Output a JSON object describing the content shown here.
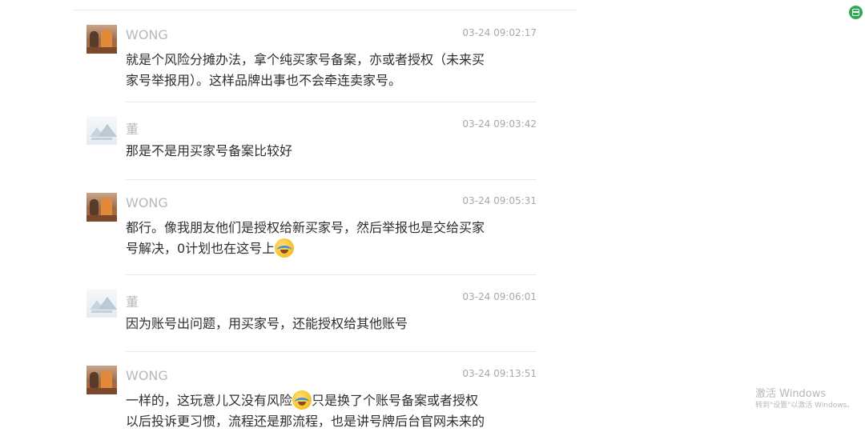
{
  "messages": [
    {
      "name": "WONG",
      "time": "03-24 09:02:17",
      "lines": [
        "就是个风险分摊办法，拿个纯买家号备案，亦或者授权（未来买",
        "家号举报用）。这样品牌出事也不会牵连卖家号。"
      ],
      "emoji": null
    },
    {
      "name": "董",
      "time": "03-24 09:03:42",
      "lines": [
        "那是不是用买家号备案比较好"
      ],
      "emoji": null
    },
    {
      "name": "WONG",
      "time": "03-24 09:05:31",
      "lines": [
        "都行。像我朋友他们是授权给新买家号，然后举报也是交给买家",
        "号解决，0计划也在这号上"
      ],
      "emoji": "crying-laughing-emoji"
    },
    {
      "name": "董",
      "time": "03-24 09:06:01",
      "lines": [
        "因为账号出问题，用买家号，还能授权给其他账号"
      ],
      "emoji": null
    },
    {
      "name": "WONG",
      "time": "03-24 09:13:51",
      "before_emoji": "一样的，这玩意儿又没有风险",
      "after_emoji": "只是换了个账号备案或者授权",
      "line2": "以后投诉更习惯，流程还是那流程，也是讲号牌后台官网未来的",
      "emoji": "crying-laughing-emoji"
    }
  ],
  "watermark": {
    "line1": "激活 Windows",
    "line2": "转到\"设置\"以激活 Windows。"
  },
  "icons": {
    "corner": "green-app-icon"
  },
  "colors": {
    "name": "#b8b8b8",
    "time": "#a8a8a8",
    "text": "#2e2e2e",
    "divider": "#e9e9e9",
    "corner_icon": "#2eaa57"
  }
}
